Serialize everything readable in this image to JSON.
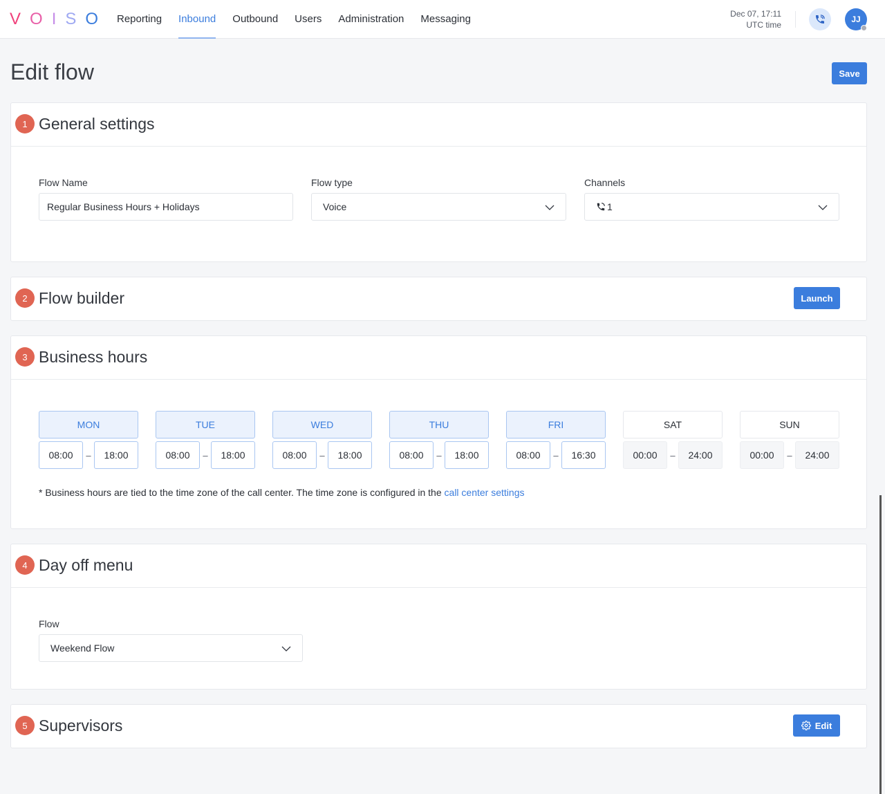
{
  "topbar": {
    "logo": [
      "V",
      "O",
      "I",
      "S",
      "O"
    ],
    "logo_colors": [
      "#f0407a",
      "#e85fa8",
      "#c68ee8",
      "#9fa9f2",
      "#3b7ddd"
    ],
    "nav": [
      {
        "label": "Reporting",
        "active": false
      },
      {
        "label": "Inbound",
        "active": true
      },
      {
        "label": "Outbound",
        "active": false
      },
      {
        "label": "Users",
        "active": false
      },
      {
        "label": "Administration",
        "active": false
      },
      {
        "label": "Messaging",
        "active": false
      }
    ],
    "clock_date": "Dec 07, 17:11",
    "clock_zone": "UTC time",
    "phone_icon": "phone-ringing-icon",
    "avatar_initials": "JJ",
    "status": "offline"
  },
  "page": {
    "title": "Edit flow",
    "save_label": "Save"
  },
  "colors": {
    "accent": "#3b7ddd",
    "step_badge": "#e06553",
    "active_day_bg": "#ebf2fd"
  },
  "general": {
    "step": "1",
    "title": "General settings",
    "flow_name_label": "Flow Name",
    "flow_name_value": "Regular Business Hours + Holidays",
    "flow_type_label": "Flow type",
    "flow_type_value": "Voice",
    "channels_label": "Channels",
    "channels_icon": "phone-ringing-icon",
    "channels_value": "1"
  },
  "builder": {
    "step": "2",
    "title": "Flow builder",
    "launch_label": "Launch"
  },
  "hours": {
    "step": "3",
    "title": "Business hours",
    "days": [
      {
        "label": "MON",
        "active": true,
        "from": "08:00",
        "to": "18:00"
      },
      {
        "label": "TUE",
        "active": true,
        "from": "08:00",
        "to": "18:00"
      },
      {
        "label": "WED",
        "active": true,
        "from": "08:00",
        "to": "18:00"
      },
      {
        "label": "THU",
        "active": true,
        "from": "08:00",
        "to": "18:00"
      },
      {
        "label": "FRI",
        "active": true,
        "from": "08:00",
        "to": "16:30"
      },
      {
        "label": "SAT",
        "active": false,
        "from": "00:00",
        "to": "24:00"
      },
      {
        "label": "SUN",
        "active": false,
        "from": "00:00",
        "to": "24:00"
      }
    ],
    "separator": "–",
    "note_text": "* Business hours are tied to the time zone of the call center. The time zone is configured in the ",
    "note_link": "call center settings"
  },
  "dayoff": {
    "step": "4",
    "title": "Day off menu",
    "flow_label": "Flow",
    "flow_value": "Weekend Flow"
  },
  "supervisors": {
    "step": "5",
    "title": "Supervisors",
    "edit_label": "Edit",
    "edit_icon": "gear-icon"
  }
}
